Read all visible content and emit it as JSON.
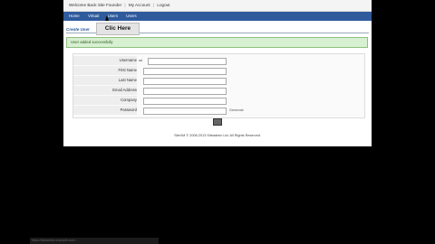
{
  "topbar": {
    "welcome": "Welcome Back Site Founder",
    "account": "My Account",
    "logout": "Logout"
  },
  "nav": [
    {
      "label": "Home"
    },
    {
      "label": "Virtual"
    },
    {
      "label": "Users"
    },
    {
      "label": "Users"
    }
  ],
  "tooltip": "Clic Here",
  "section_title": "Create User",
  "success_message": "User added successfully",
  "form": {
    "fields": [
      {
        "label": "Username",
        "prefix": "ad",
        "value": ""
      },
      {
        "label": "First Name",
        "value": ""
      },
      {
        "label": "Last Name",
        "value": ""
      },
      {
        "label": "Email Address",
        "value": ""
      },
      {
        "label": "Company",
        "value": ""
      },
      {
        "label": "Password",
        "value": "",
        "after": "Generate"
      }
    ]
  },
  "footer": "SiteVM © 2008-2013 Siteadmin Ltd. All Rights Reserved.",
  "statusbar": "https://siteadmin.example.com/..."
}
